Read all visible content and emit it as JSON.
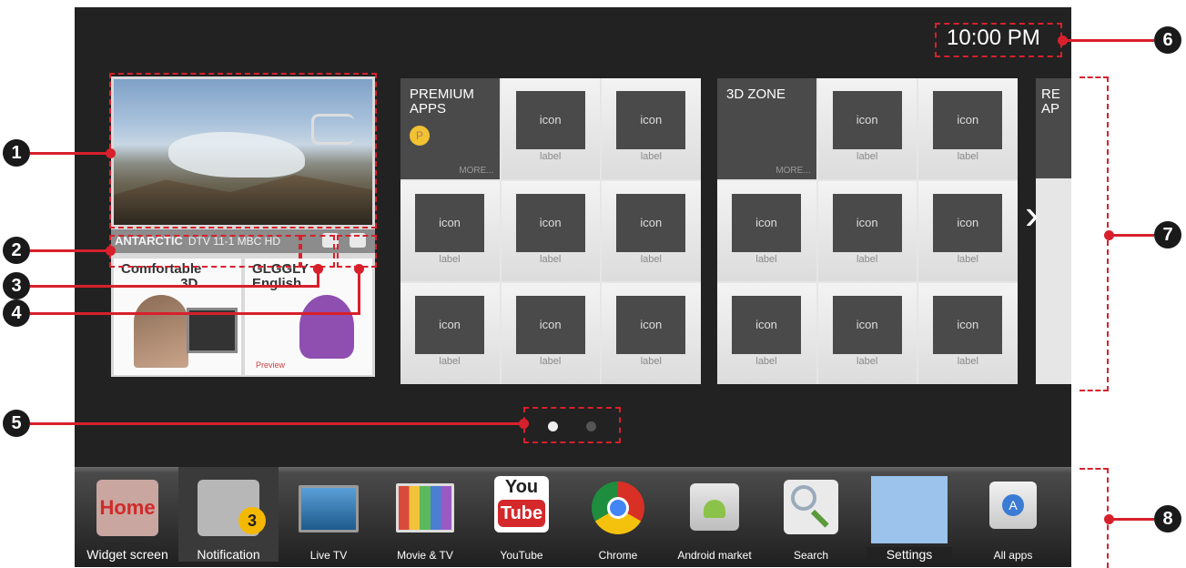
{
  "screen": {
    "clock": "10:00 PM",
    "live_tv": {
      "channel_name": "ANTARCTIC",
      "channel_info": "DTV 11-1 MBC HD",
      "thumbnails": [
        {
          "title_line1": "Comfortable",
          "title_line2": "3D"
        },
        {
          "title_line1": "GLGGLY",
          "title_line2": "English",
          "caption": "Preview"
        }
      ]
    },
    "panels": [
      {
        "title_line1": "PREMIUM",
        "title_line2": "APPS",
        "more": "MORE...",
        "badge": "P",
        "cells": [
          {
            "icon": "icon",
            "label": "label"
          },
          {
            "icon": "icon",
            "label": "label"
          },
          {
            "icon": "icon",
            "label": "label"
          },
          {
            "icon": "icon",
            "label": "label"
          },
          {
            "icon": "icon",
            "label": "label"
          },
          {
            "icon": "icon",
            "label": "label"
          },
          {
            "icon": "icon",
            "label": "label"
          },
          {
            "icon": "icon",
            "label": "label"
          }
        ]
      },
      {
        "title_line1": "3D ZONE",
        "title_line2": "",
        "more": "MORE...",
        "cells": [
          {
            "icon": "icon",
            "label": "label"
          },
          {
            "icon": "icon",
            "label": "label"
          },
          {
            "icon": "icon",
            "label": "label"
          },
          {
            "icon": "icon",
            "label": "label"
          },
          {
            "icon": "icon",
            "label": "label"
          },
          {
            "icon": "icon",
            "label": "label"
          },
          {
            "icon": "icon",
            "label": "label"
          },
          {
            "icon": "icon",
            "label": "label"
          }
        ]
      }
    ],
    "partial_panel": {
      "title_line1": "RE",
      "title_line2": "AP"
    },
    "page_indicator": {
      "pages": 2,
      "current": 1
    }
  },
  "callouts": [
    "1",
    "2",
    "3",
    "4",
    "5",
    "6",
    "7",
    "8"
  ],
  "launcher": {
    "items": [
      {
        "label": "Widget screen",
        "icon": "home-icon",
        "logo_text": "Home"
      },
      {
        "label": "Notification",
        "icon": "notification-icon",
        "badge": "3"
      },
      {
        "label": "Live TV",
        "icon": "tv-icon"
      },
      {
        "label": "Movie & TV",
        "icon": "film-icon"
      },
      {
        "label": "YouTube",
        "icon": "youtube-icon",
        "logo_line1": "You",
        "logo_line2": "Tube"
      },
      {
        "label": "Chrome",
        "icon": "chrome-icon"
      },
      {
        "label": "Android market",
        "icon": "android-market-icon"
      },
      {
        "label": "Search",
        "icon": "search-icon"
      },
      {
        "label": "Settings",
        "icon": "settings-icon"
      },
      {
        "label": "All apps",
        "icon": "all-apps-icon"
      }
    ]
  },
  "colors": {
    "callout": "#d8202c",
    "screen_bg": "#222222",
    "badge": "#f5b800"
  }
}
